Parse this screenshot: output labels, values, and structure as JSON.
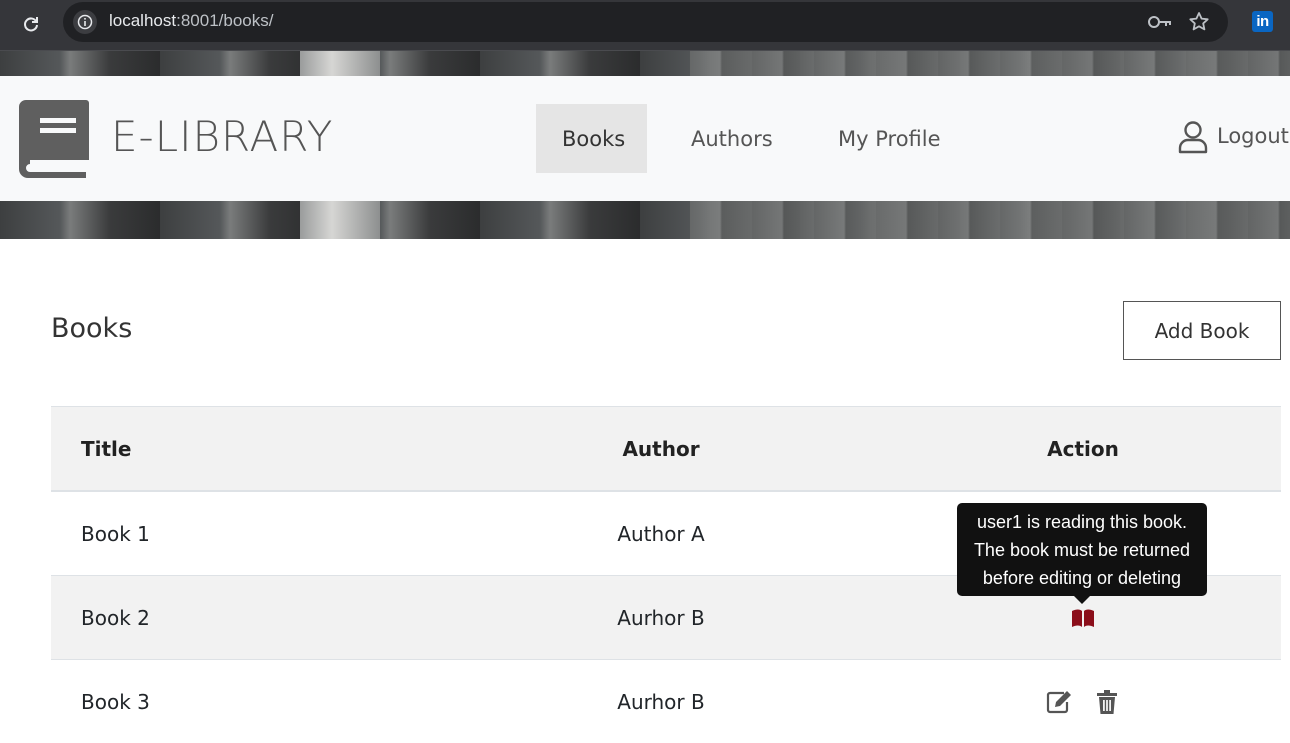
{
  "browser": {
    "url_host": "localhost",
    "url_path": ":8001/books/"
  },
  "navbar": {
    "brand": "E-LIBRARY",
    "items": [
      {
        "label": "Books",
        "active": true
      },
      {
        "label": "Authors",
        "active": false
      },
      {
        "label": "My Profile",
        "active": false
      }
    ],
    "logout_label": "Logout"
  },
  "main": {
    "title": "Books",
    "add_button_label": "Add Book"
  },
  "table": {
    "headers": {
      "title": "Title",
      "author": "Author",
      "action": "Action"
    },
    "rows": [
      {
        "title": "Book 1",
        "author": "Author A",
        "action": "reading"
      },
      {
        "title": "Book 2",
        "author": "Aurhor B",
        "action": "reading"
      },
      {
        "title": "Book 3",
        "author": "Aurhor B",
        "action": "edit-delete"
      }
    ]
  },
  "tooltip": {
    "line1": "user1 is reading this book.",
    "line2": "The book must be returned",
    "line3": "before editing or deleting"
  },
  "colors": {
    "reading_icon": "#8b0e1a",
    "action_icon": "#555555"
  }
}
